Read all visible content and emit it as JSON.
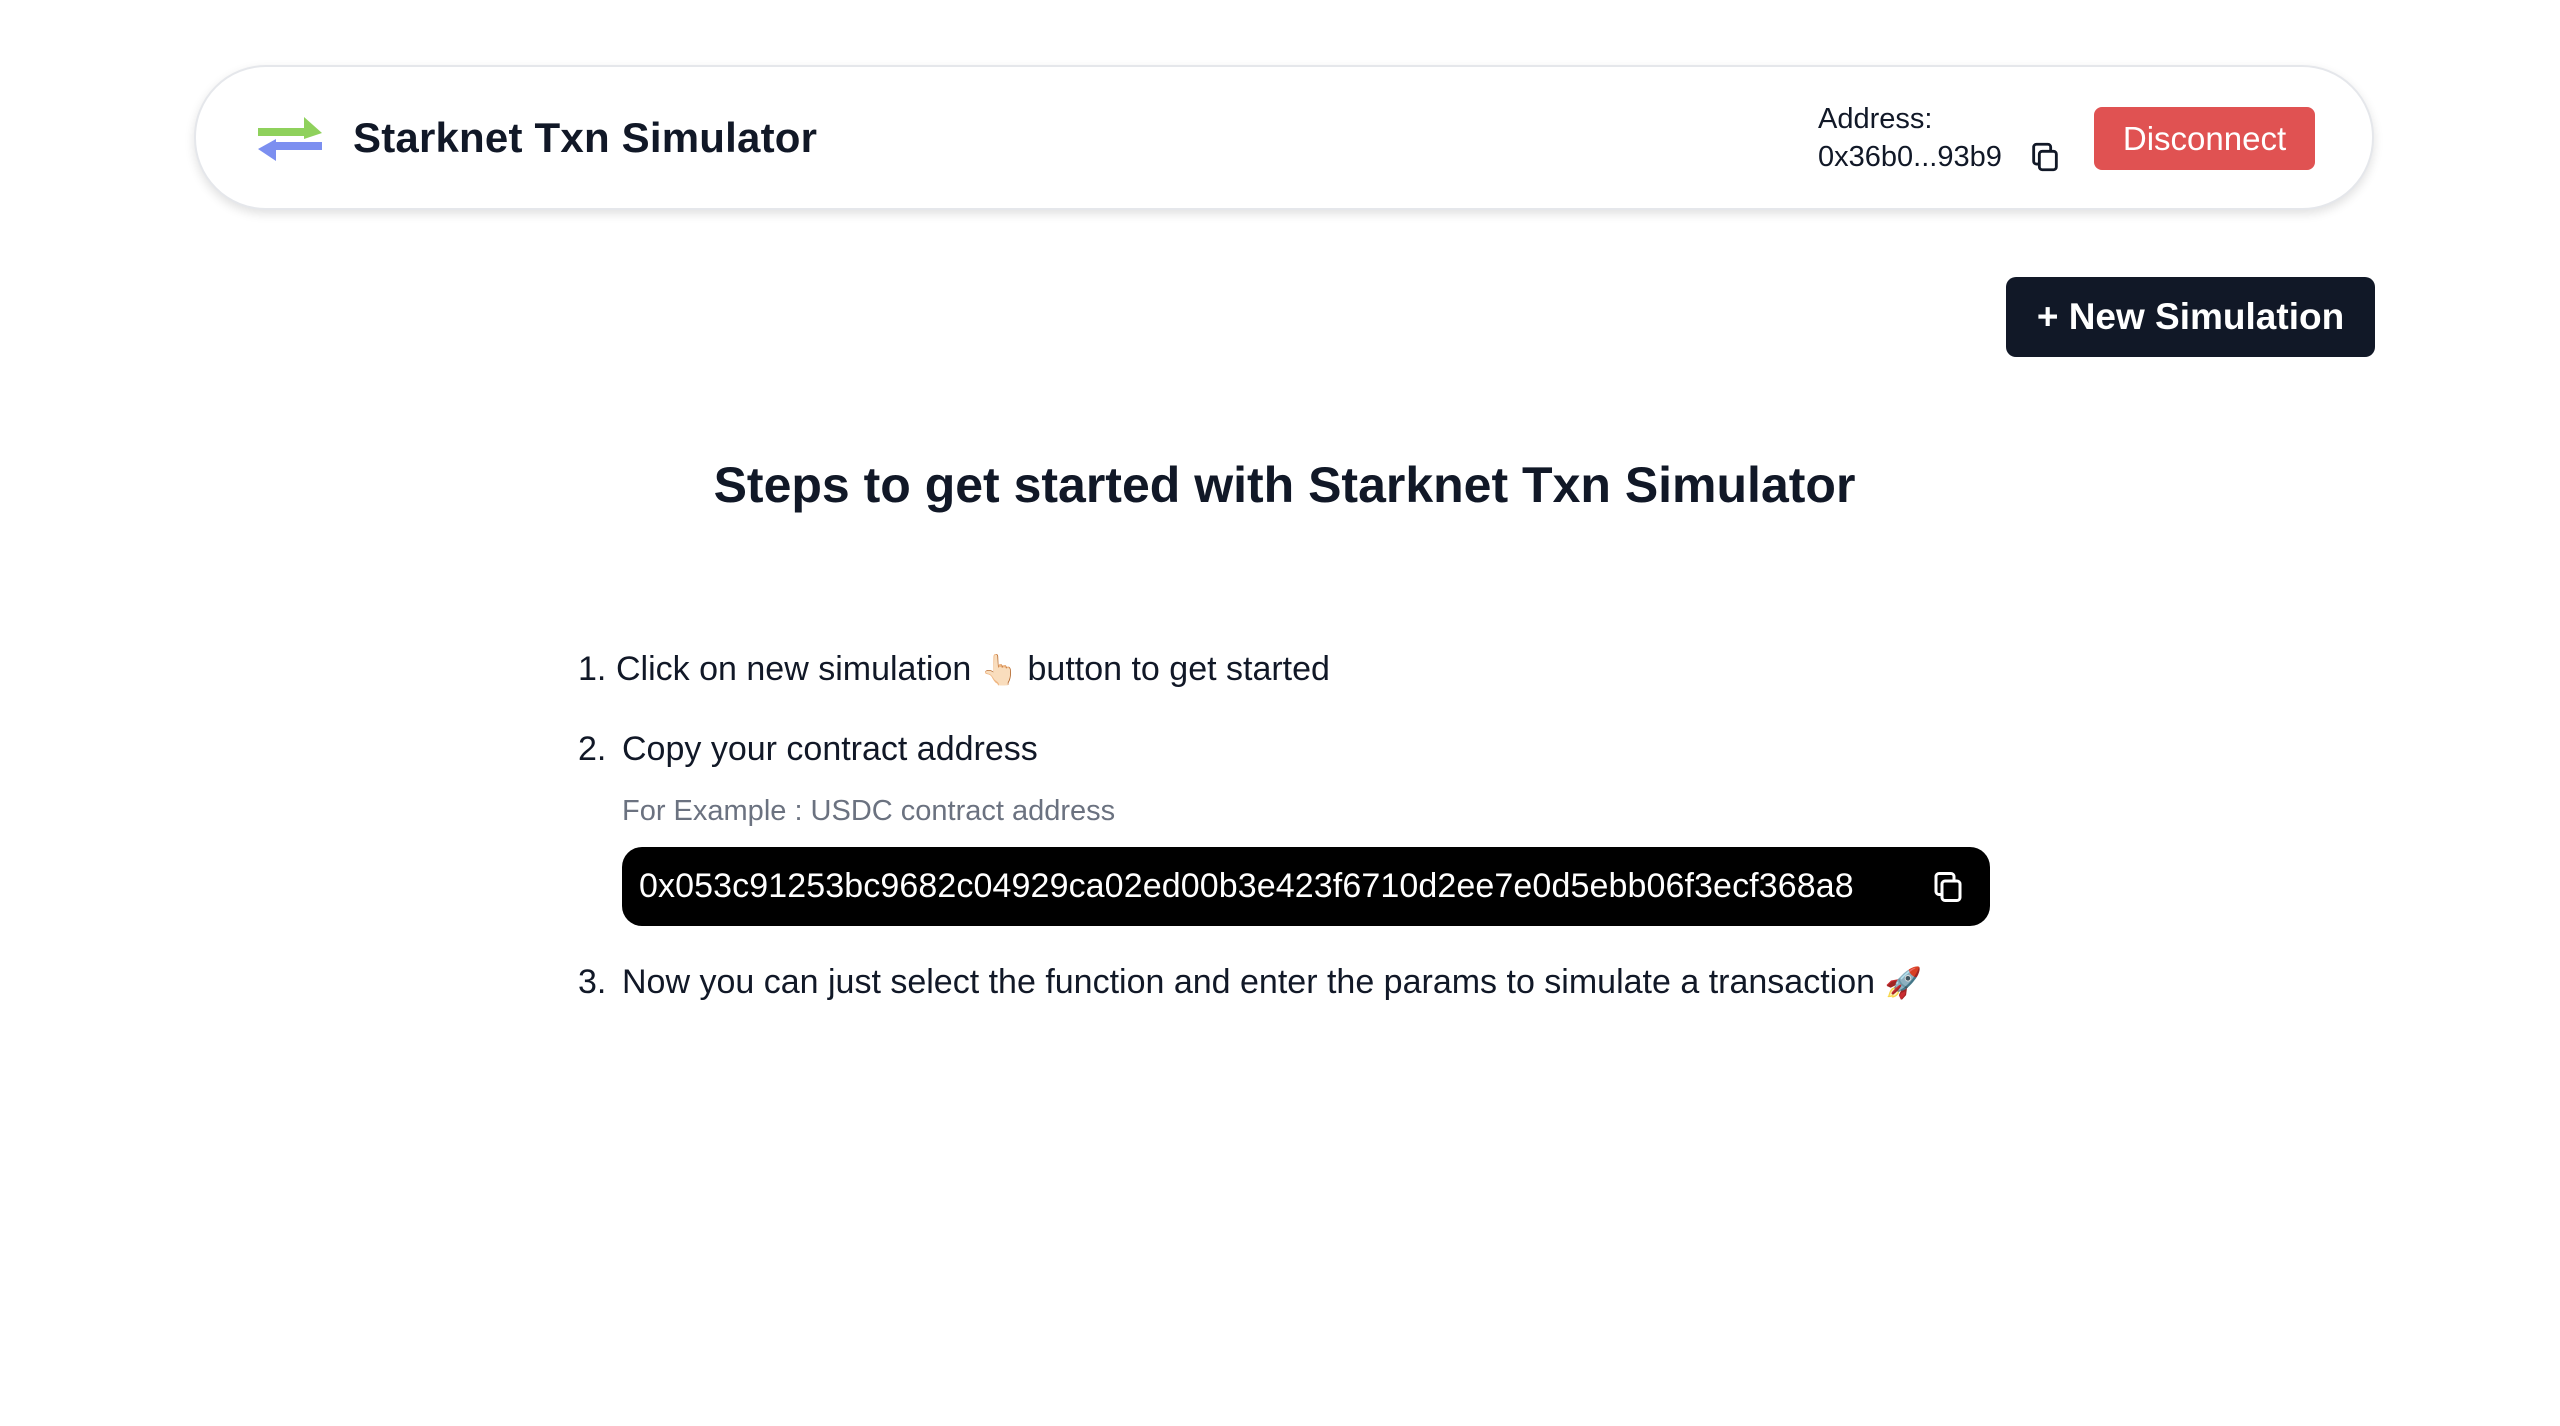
{
  "header": {
    "title": "Starknet Txn Simulator",
    "logo_icon": "swap-arrows-icon",
    "address_label": "Address:",
    "address_value": "0x36b0...93b9",
    "disconnect_label": "Disconnect",
    "colors": {
      "disconnect": "#e05252",
      "logo_top_arrow": "#8fd15c",
      "logo_bottom_arrow": "#7c8ff0"
    }
  },
  "actions": {
    "new_simulation_label": "+ New Simulation",
    "new_simulation_color": "#111827"
  },
  "main": {
    "heading": "Steps to get started with Starknet Txn Simulator",
    "steps": [
      {
        "number": "1.",
        "text_before": "Click on new simulation ",
        "emoji": "👆🏻",
        "text_after": " button to get started"
      },
      {
        "number": "2.",
        "text": "Copy your contract address",
        "example_label": "For Example : USDC contract address",
        "contract_address": "0x053c91253bc9682c04929ca02ed00b3e423f6710d2ee7e0d5ebb06f3ecf368a8"
      },
      {
        "number": "3.",
        "text": "Now you can just select the function and enter the params to simulate a transaction ",
        "emoji": "🚀"
      }
    ]
  }
}
